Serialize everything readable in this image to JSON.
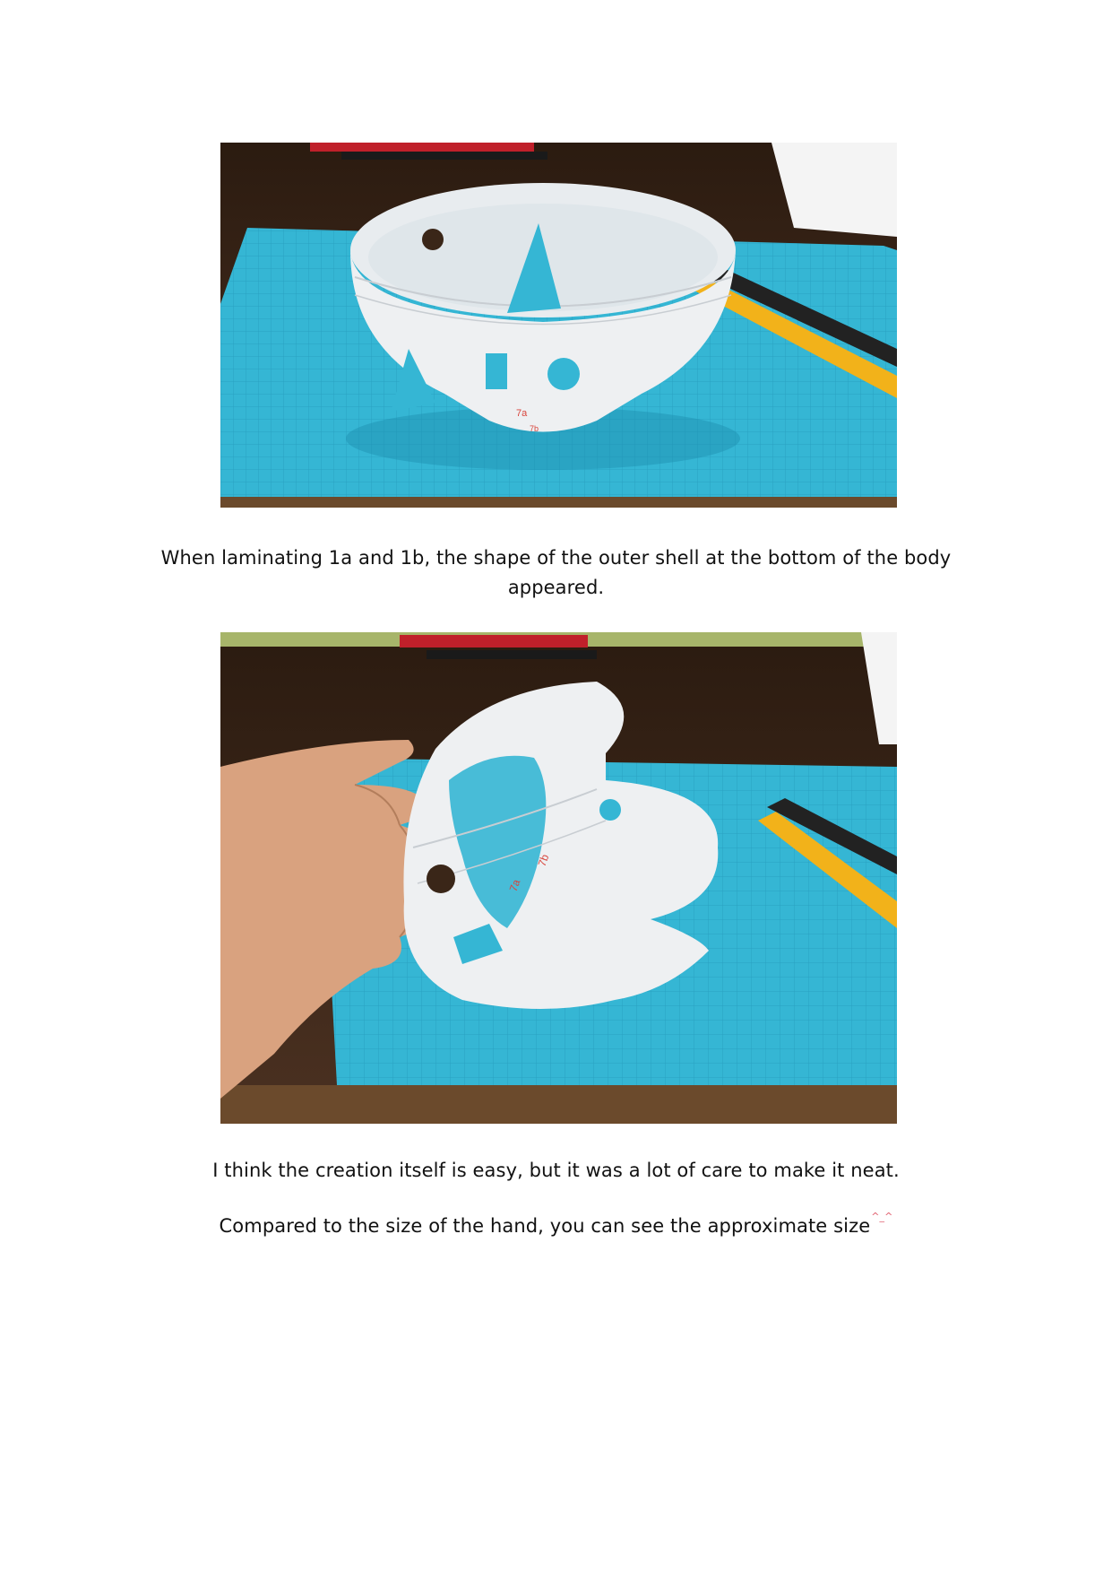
{
  "captions": {
    "first": "When laminating 1a and 1b, the shape of the outer shell at the bottom of the body appeared.",
    "second": "I think the creation itself is easy, but it was a lot of care to make it neat.",
    "third": "Compared to the size of the hand, you can see the approximate size",
    "third_emoticon": "^_^"
  },
  "photos": {
    "first": {
      "part_labels": [
        "7a",
        "7b"
      ]
    },
    "second": {
      "part_labels": [
        "7a",
        "7b"
      ]
    }
  },
  "colors": {
    "cutting_mat": "#35b6d4",
    "table": "#3a2618",
    "paper": "#eef0f2",
    "part_label": "#d8453c",
    "knife_handle": "#f2b21a"
  }
}
